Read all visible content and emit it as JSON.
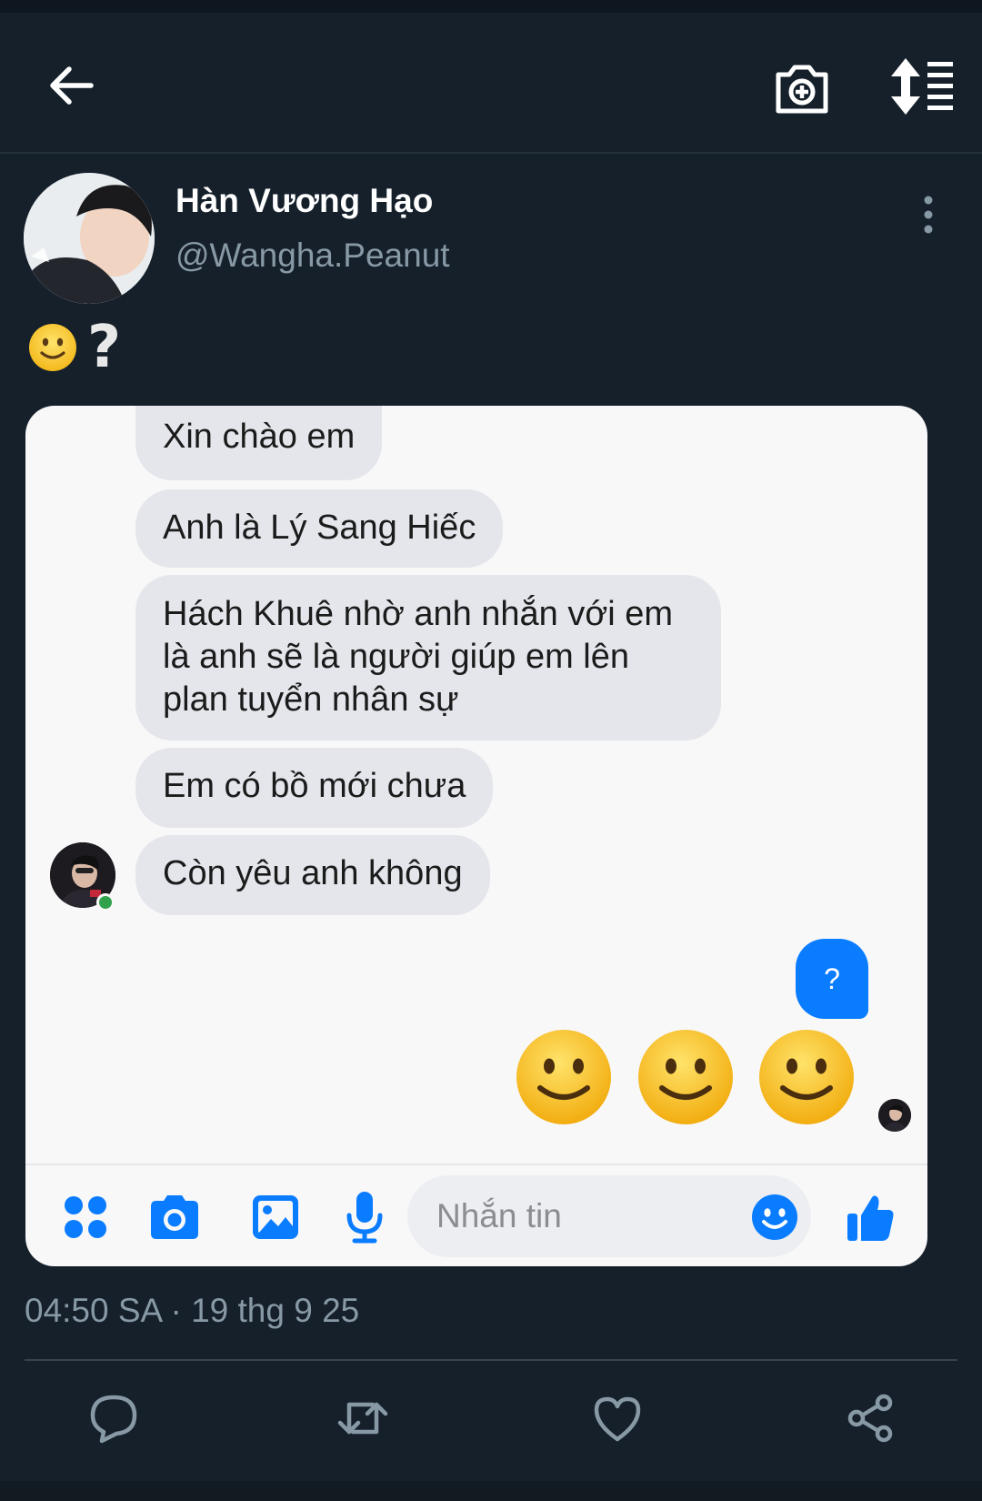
{
  "app": {
    "name": "Twitter",
    "colors": {
      "background": "#15202b",
      "secondary_text": "#8899a6",
      "messenger_blue": "#0a7cff",
      "bubble_grey": "#e4e6eb"
    }
  },
  "header": {
    "icons": [
      "back-arrow-icon",
      "camera-add-icon",
      "sort-icon"
    ]
  },
  "author": {
    "name": "Hàn Vương Hạo",
    "handle": "@Wangha.Peanut"
  },
  "tweet": {
    "text_emoji": "slightly-smiling-face",
    "text_mark": "?"
  },
  "screenshot": {
    "received_messages": [
      "Xin chào em",
      "Anh là Lý Sang Hiếc",
      "Hách Khuê nhờ anh nhắn với em là anh sẽ là người giúp em lên plan tuyển nhân sự",
      "Em có bồ mới chưa",
      "Còn yêu anh không"
    ],
    "sent_message": "?",
    "sent_emoji_count": 3,
    "composer": {
      "placeholder": "Nhắn tin",
      "tools": [
        "apps-icon",
        "camera-icon",
        "gallery-icon",
        "microphone-icon",
        "emoji-icon",
        "thumbs-up-icon"
      ]
    }
  },
  "meta": {
    "timestamp": "04:50 SA · 19 thg 9 25"
  },
  "actions": [
    "reply-icon",
    "retweet-icon",
    "like-icon",
    "share-icon"
  ]
}
